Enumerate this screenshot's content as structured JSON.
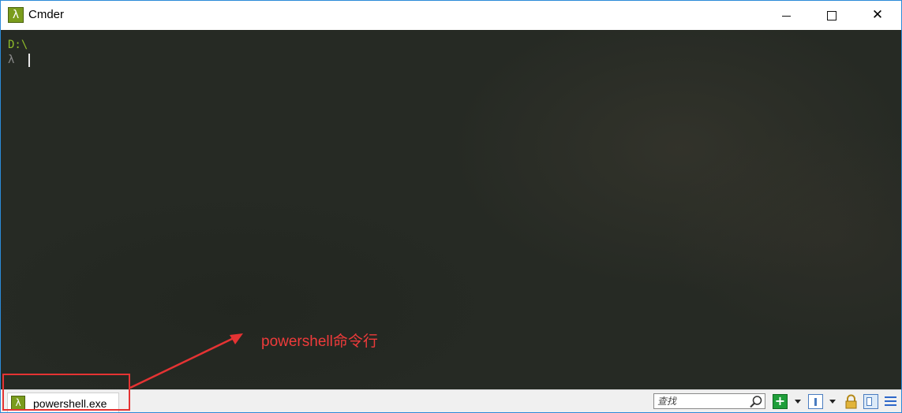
{
  "window": {
    "title": "Cmder",
    "app_icon_glyph": "λ",
    "controls": {
      "minimize": "minimize",
      "maximize": "maximize",
      "close": "✕"
    }
  },
  "console": {
    "path_line": "D:\\",
    "prompt_symbol": "λ"
  },
  "annotation": {
    "text": "powershell命令行",
    "color": "#ef3b3b"
  },
  "statusbar": {
    "tab": {
      "icon_glyph": "λ",
      "label": "powershell.exe"
    },
    "search": {
      "placeholder": "查找"
    },
    "icons": [
      "plus-icon",
      "split-view-icon",
      "lock-icon",
      "panel-icon",
      "menu-icon"
    ]
  },
  "colors": {
    "console_bg": "#262a24",
    "path_green": "#8fbc2a",
    "prompt_gray": "#8a8a8a",
    "accent_blue": "#2b8ad8"
  }
}
